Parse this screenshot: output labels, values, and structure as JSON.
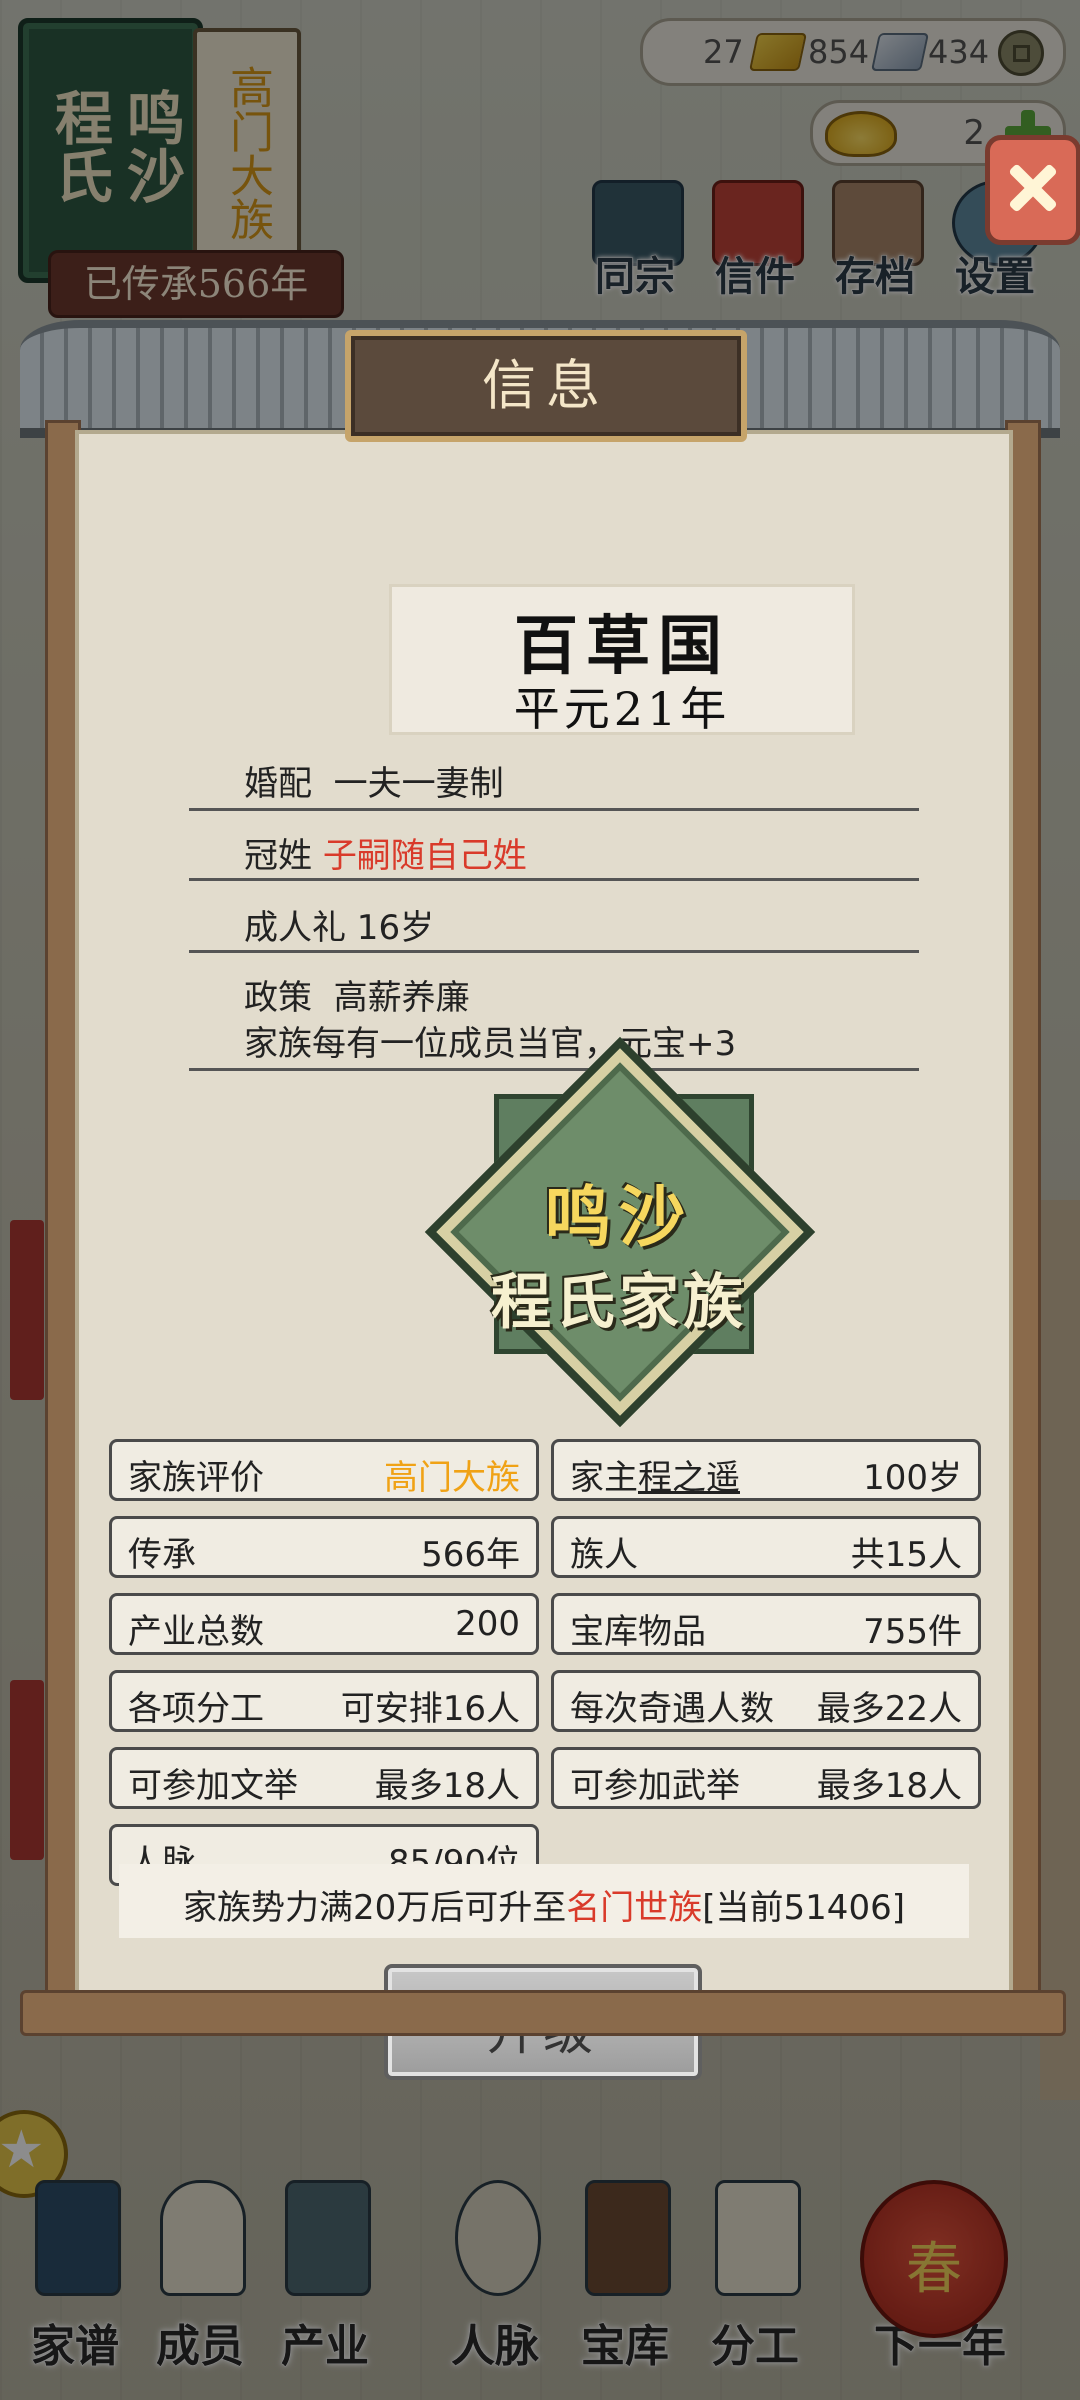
{
  "family": {
    "name": "鸣沙程氏",
    "rank": "高门大族",
    "inherited": "已传承566年"
  },
  "currency": {
    "gold": "27",
    "silver": "854",
    "coins": "434",
    "yuanbao": "2"
  },
  "top_menu": [
    {
      "label": "同宗",
      "icon": "clan-book-icon"
    },
    {
      "label": "信件",
      "icon": "letter-icon"
    },
    {
      "label": "存档",
      "icon": "save-scroll-icon"
    },
    {
      "label": "设置",
      "icon": "gear-icon"
    }
  ],
  "modal": {
    "title": "信息",
    "nation": {
      "name": "百草国",
      "era": "平元21年"
    },
    "rows": {
      "marriage_label": "婚配",
      "marriage_value": "一夫一妻制",
      "surname_label": "冠姓",
      "surname_value": "子嗣随自己姓",
      "coming_of_age": "成人礼 16岁",
      "policy_label": "政策",
      "policy_value": "高薪养廉",
      "policy_effect": "家族每有一位成员当官，元宝+3"
    },
    "emblem": {
      "line1": "鸣沙",
      "line2": "程氏家族"
    },
    "stats": {
      "rating_label": "家族评价",
      "rating_value": "高门大族",
      "head_label": "家主",
      "head_name": "程之遥",
      "head_age": "100岁",
      "inherit_label": "传承",
      "inherit_value": "566年",
      "members_label": "族人",
      "members_value": "共15人",
      "industry_label": "产业总数",
      "industry_value": "200",
      "treasury_label": "宝库物品",
      "treasury_value": "755件",
      "division_label": "各项分工",
      "division_value": "可安排16人",
      "encounter_label": "每次奇遇人数",
      "encounter_value": "最多22人",
      "civil_exam_label": "可参加文举",
      "civil_exam_value": "最多18人",
      "military_exam_label": "可参加武举",
      "military_exam_value": "最多18人",
      "connections_label": "人脉",
      "connections_value": "85/90位"
    },
    "upgrade_note": {
      "prefix": "家族势力满20万后可升至",
      "target": "名门世族",
      "current": "[当前51406]"
    },
    "upgrade_button": "升级"
  },
  "bottom_nav": [
    {
      "label": "家谱",
      "icon": "genealogy-book-icon"
    },
    {
      "label": "成员",
      "icon": "member-portrait-icon"
    },
    {
      "label": "产业",
      "icon": "building-icon"
    },
    {
      "label": "人脉",
      "icon": "network-icon"
    },
    {
      "label": "宝库",
      "icon": "treasure-chest-icon"
    },
    {
      "label": "分工",
      "icon": "scroll-icon"
    },
    {
      "label": "下一年",
      "icon": "lantern-icon"
    }
  ],
  "next_year_glyph": "春"
}
